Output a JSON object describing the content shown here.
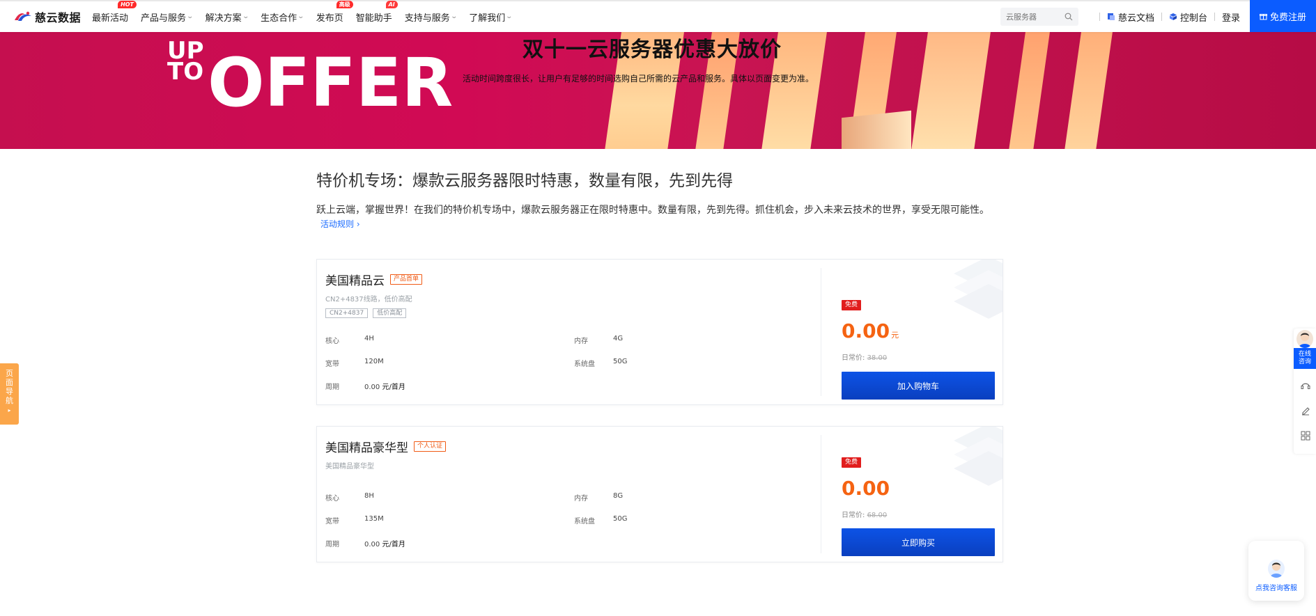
{
  "header": {
    "logo_text": "慈云数据",
    "nav": [
      {
        "label": "最新活动",
        "badge": "HOT",
        "chevron": false
      },
      {
        "label": "产品与服务",
        "badge": "",
        "chevron": true
      },
      {
        "label": "解决方案",
        "badge": "",
        "chevron": true
      },
      {
        "label": "生态合作",
        "badge": "",
        "chevron": true
      },
      {
        "label": "发布页",
        "badge": "高级",
        "chevron": false
      },
      {
        "label": "智能助手",
        "badge": "AI",
        "chevron": false
      },
      {
        "label": "支持与服务",
        "badge": "",
        "chevron": true
      },
      {
        "label": "了解我们",
        "badge": "",
        "chevron": true
      }
    ],
    "search_placeholder": "云服务器",
    "docs_label": "慈云文档",
    "console_label": "控制台",
    "login_label": "登录",
    "register_label": "免费注册"
  },
  "banner": {
    "title": "双十一云服务器优惠大放价",
    "subtitle": "活动时间跨度很长，让用户有足够的时间选购自己所需的云产品和服务。具体以页面变更为准。",
    "art_text_top": "UP",
    "art_text_bottom": "TO",
    "art_text_big": "OFFER"
  },
  "section": {
    "title": "特价机专场：爆款云服务器限时特惠，数量有限，先到先得",
    "desc": "跃上云端，掌握世界！在我们的特价机专场中，爆款云服务器正在限时特惠中。数量有限，先到先得。抓住机会，步入未来云技术的世界，享受无限可能性。",
    "rules_link": "活动规则 ›"
  },
  "products": [
    {
      "name": "美国精品云",
      "tag": "产品首单",
      "subtitle": "CN2+4837线路，低价高配",
      "chips": [
        "CN2+4837",
        "低价高配"
      ],
      "specs": {
        "cpu_label": "核心",
        "cpu": "4H",
        "mem_label": "内存",
        "mem": "4G",
        "bw_label": "宽带",
        "bw": "120M",
        "disk_label": "系统盘",
        "disk": "50G",
        "period_label": "周期",
        "period_price": "0.00",
        "period_unit": "元/首月"
      },
      "badge": "免费",
      "price": "0.00",
      "price_unit": "元",
      "orig_label": "日常价:",
      "orig_price": "38.00",
      "button": "加入购物车"
    },
    {
      "name": "美国精品豪华型",
      "tag": "个人认证",
      "subtitle": "美国精品豪华型",
      "chips": [],
      "specs": {
        "cpu_label": "核心",
        "cpu": "8H",
        "mem_label": "内存",
        "mem": "8G",
        "bw_label": "宽带",
        "bw": "135M",
        "disk_label": "系统盘",
        "disk": "50G",
        "period_label": "周期",
        "period_price": "0.00",
        "period_unit": "元/首月"
      },
      "badge": "免费",
      "price": "0.00",
      "price_unit": "",
      "orig_label": "日常价:",
      "orig_price": "68.00",
      "button": "立即购买"
    }
  ],
  "side": {
    "page_nav": "页面导航",
    "page_nav_arrow": "▸",
    "consult_line1": "在线",
    "consult_line2": "咨询",
    "chat_label": "点我咨询客服"
  },
  "colors": {
    "accent_blue": "#0b5cff",
    "price_orange": "#f56312",
    "badge_red": "#e11d1d",
    "banner_crimson": "#c50f4f"
  }
}
